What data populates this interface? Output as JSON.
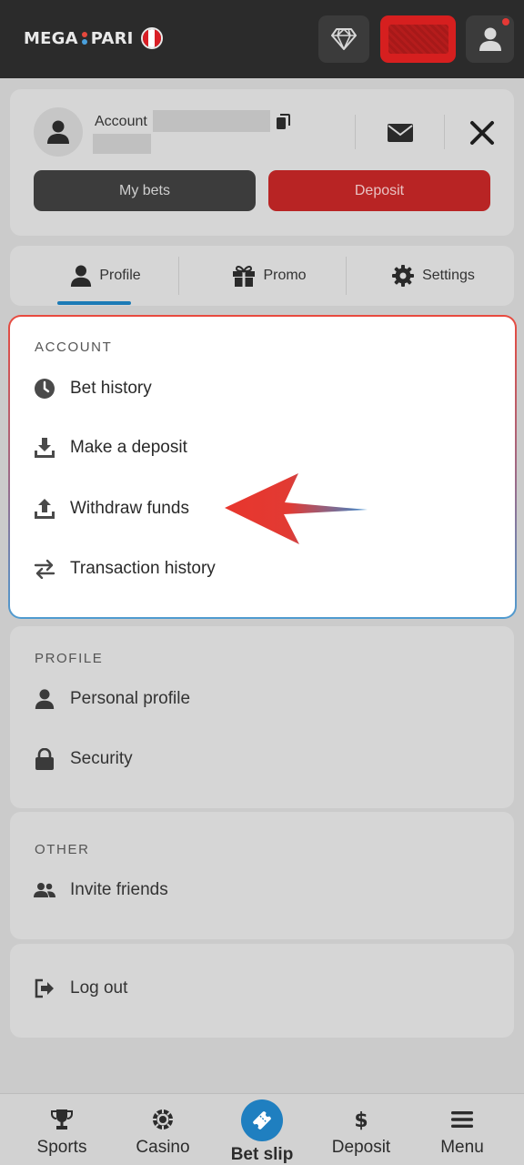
{
  "header": {
    "logo_text_1": "MEGA",
    "logo_text_2": "PARI",
    "icons": [
      "diamond-icon",
      "balance-hidden",
      "user-icon"
    ]
  },
  "account": {
    "label": "Account",
    "my_bets_label": "My bets",
    "deposit_label": "Deposit"
  },
  "tabs": [
    {
      "label": "Profile",
      "icon": "person-icon",
      "active": true
    },
    {
      "label": "Promo",
      "icon": "gift-icon"
    },
    {
      "label": "Settings",
      "icon": "gear-icon"
    }
  ],
  "sections": {
    "account": {
      "title": "ACCOUNT",
      "items": [
        {
          "label": "Bet history",
          "icon": "clock-icon"
        },
        {
          "label": "Make a deposit",
          "icon": "download-icon"
        },
        {
          "label": "Withdraw funds",
          "icon": "upload-icon"
        },
        {
          "label": "Transaction history",
          "icon": "transfer-icon"
        }
      ]
    },
    "profile": {
      "title": "PROFILE",
      "items": [
        {
          "label": "Personal profile",
          "icon": "person-icon"
        },
        {
          "label": "Security",
          "icon": "lock-icon"
        }
      ]
    },
    "other": {
      "title": "OTHER",
      "items": [
        {
          "label": "Invite friends",
          "icon": "group-icon"
        }
      ]
    },
    "logout": {
      "label": "Log out",
      "icon": "logout-icon"
    }
  },
  "bottom_nav": [
    {
      "label": "Sports",
      "icon": "trophy-icon"
    },
    {
      "label": "Casino",
      "icon": "chip-icon"
    },
    {
      "label": "Bet slip",
      "icon": "ticket-icon",
      "active": true
    },
    {
      "label": "Deposit",
      "icon": "dollar-icon"
    },
    {
      "label": "Menu",
      "icon": "menu-icon"
    }
  ],
  "colors": {
    "brand_red": "#d61f1f",
    "accent_blue": "#1f7fc0",
    "topbar": "#2b2b2b"
  }
}
